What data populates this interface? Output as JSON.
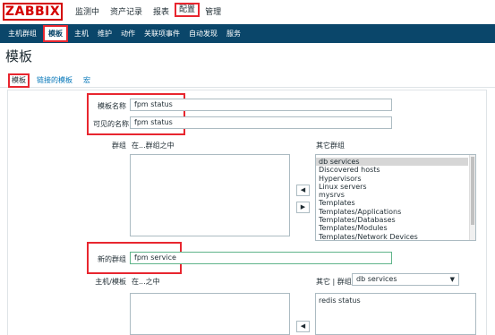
{
  "header": {
    "logo": "ZABBIX",
    "menu": [
      "监测中",
      "资产记录",
      "报表",
      "配置",
      "管理"
    ],
    "active_menu": "配置"
  },
  "subnav": {
    "items": [
      "主机群组",
      "模板",
      "主机",
      "维护",
      "动作",
      "关联项事件",
      "自动发现",
      "服务"
    ],
    "active": "模板"
  },
  "page": {
    "title": "模板"
  },
  "tabs": [
    "模板",
    "链接的模板",
    "宏"
  ],
  "form": {
    "template_name_label": "模板名称",
    "template_name_value": "fpm status",
    "visible_name_label": "可见的名称",
    "visible_name_value": "fpm status",
    "groups_label": "群组",
    "in_groups_label": "在...群组之中",
    "other_groups_label": "其它群组",
    "other_groups": [
      "db services",
      "Discovered hosts",
      "Hypervisors",
      "Linux servers",
      "mysrvs",
      "Templates",
      "Templates/Applications",
      "Templates/Databases",
      "Templates/Modules",
      "Templates/Network Devices"
    ],
    "selected_other_group": "db services",
    "move_left": "◀",
    "move_right": "▶",
    "new_group_label": "新的群组",
    "new_group_value": "fpm service",
    "host_template_label": "主机/模板",
    "in_label": "在...之中",
    "other_group_label": "其它 | 群组",
    "other_group_select": "db services",
    "other_hosts": [
      "redis status"
    ]
  },
  "colors": {
    "nav_bg": "#0a466a",
    "highlight": "#e8262f",
    "link": "#0275b8",
    "brand": "#d40000"
  }
}
